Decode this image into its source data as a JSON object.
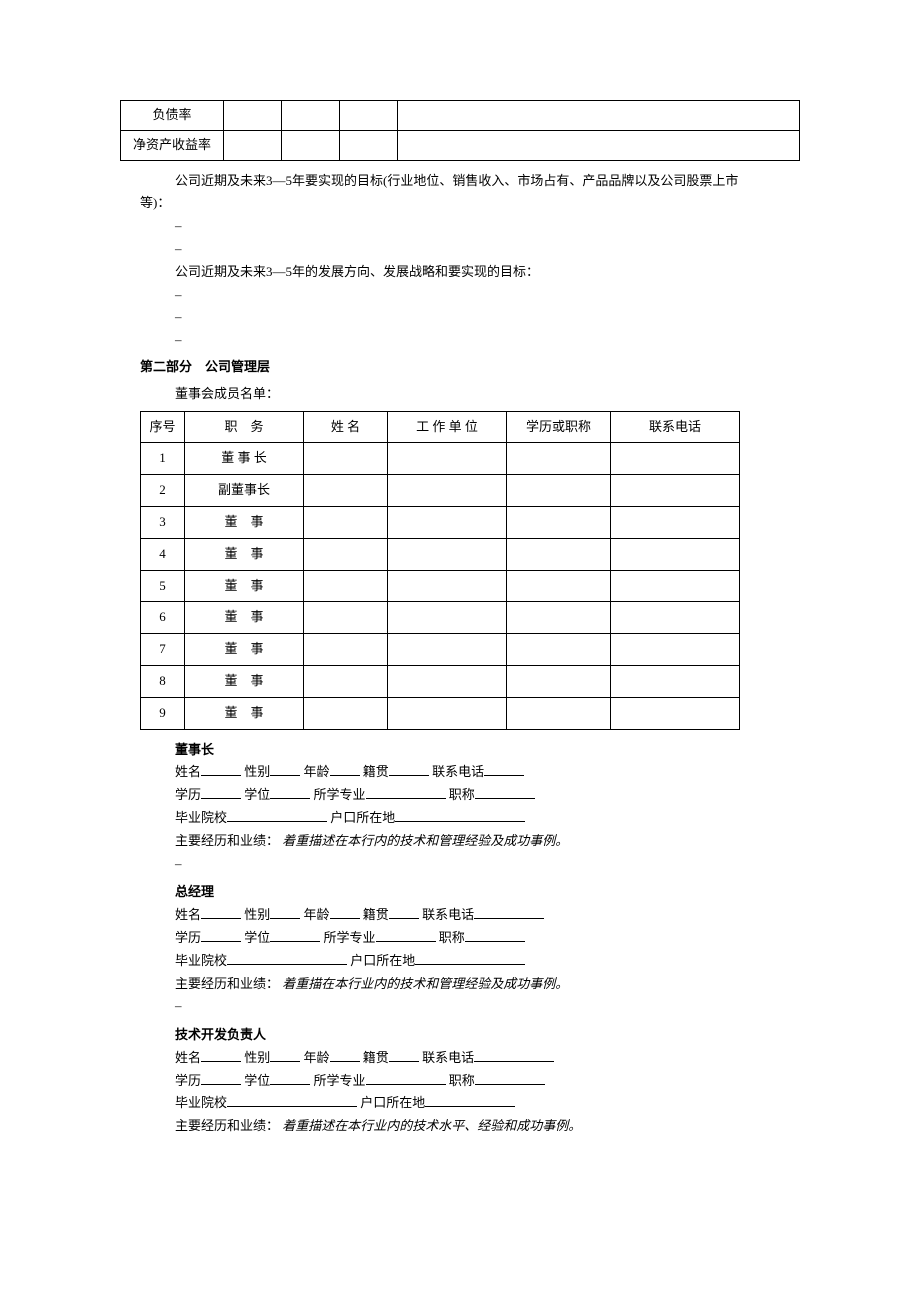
{
  "financeTable": {
    "rows": [
      "负债率",
      "净资产收益率"
    ]
  },
  "goals": {
    "intro1_a": "公司近期及未来3—5年要实现的目标(行业地位、销售收入、市场占有、产品品牌以及公司股票上市",
    "intro1_b": "等)：",
    "intro2": "公司近期及未来3—5年的发展方向、发展战略和要实现的目标："
  },
  "section2": "第二部分　公司管理层",
  "board": {
    "title": "董事会成员名单：",
    "headers": [
      "序号",
      "职　务",
      "姓 名",
      "工 作 单 位",
      "学历或职称",
      "联系电话"
    ],
    "rows": [
      {
        "seq": "1",
        "pos": "董 事 长"
      },
      {
        "seq": "2",
        "pos": "副董事长"
      },
      {
        "seq": "3",
        "pos": "董　事"
      },
      {
        "seq": "4",
        "pos": "董　事"
      },
      {
        "seq": "5",
        "pos": "董　事"
      },
      {
        "seq": "6",
        "pos": "董　事"
      },
      {
        "seq": "7",
        "pos": "董　事"
      },
      {
        "seq": "8",
        "pos": "董　事"
      },
      {
        "seq": "9",
        "pos": "董　事"
      }
    ]
  },
  "labels": {
    "name": "姓名",
    "gender": "性别",
    "age": "年龄",
    "origin": "籍贯",
    "phone": "联系电话",
    "edu": "学历",
    "degree": "学位",
    "major": "所学专业",
    "title": "职称",
    "school": "毕业院校",
    "hukou": "户口所在地",
    "exp": "主要经历和业绩："
  },
  "people": {
    "chairman": {
      "title": "董事长",
      "expNote": "着重描述在本行内的技术和管理经验及成功事例。"
    },
    "gm": {
      "title": "总经理",
      "expNote": "着重描在本行业内的技术和管理经验及成功事例。"
    },
    "tech": {
      "title": "技术开发负责人",
      "expNote": "着重描述在本行业内的技术水平、经验和成功事例。"
    }
  }
}
